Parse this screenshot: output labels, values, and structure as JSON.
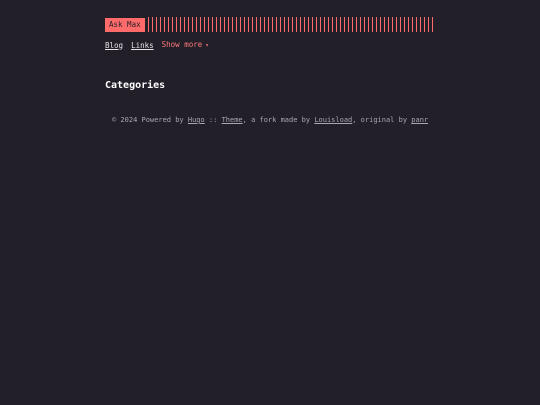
{
  "header": {
    "logo_text": "Ask Max"
  },
  "nav": {
    "items": [
      {
        "label": "Blog"
      },
      {
        "label": "Links"
      }
    ],
    "show_more_label": "Show more",
    "show_more_chevron": "▾"
  },
  "main": {
    "title": "Categories"
  },
  "footer": {
    "prefix": "© 2024 Powered by ",
    "hugo_link": "Hugo",
    "separator": " :: ",
    "theme_link": "Theme",
    "fork_text": ", a fork made by ",
    "louisload_link": "Louisload",
    "original_text": ", original by ",
    "panr_link": "panr"
  },
  "colors": {
    "background": "#221f29",
    "accent": "#ff6b6b"
  }
}
